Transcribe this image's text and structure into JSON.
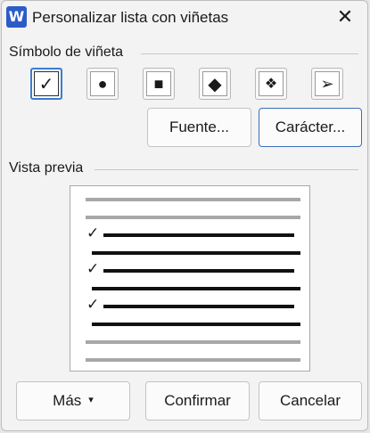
{
  "window": {
    "app_icon_letter": "W",
    "title": "Personalizar lista con viñetas",
    "close_glyph": "✕"
  },
  "bullet_symbol": {
    "label": "Símbolo de viñeta",
    "symbols": [
      {
        "glyph": "✓",
        "icon": "check-mark-icon",
        "selected": true
      },
      {
        "glyph": "●",
        "icon": "filled-circle-icon",
        "selected": false
      },
      {
        "glyph": "■",
        "icon": "filled-square-icon",
        "selected": false
      },
      {
        "glyph": "◆",
        "icon": "filled-diamond-icon",
        "selected": false
      },
      {
        "glyph": "❖",
        "icon": "four-diamonds-icon",
        "selected": false
      },
      {
        "glyph": "➢",
        "icon": "arrowhead-icon",
        "selected": false
      }
    ],
    "font_button": "Fuente...",
    "character_button": "Carácter..."
  },
  "preview": {
    "label": "Vista previa",
    "bullet_glyph": "✓"
  },
  "footer": {
    "more_button": "Más",
    "more_arrow": "▾",
    "confirm_button": "Confirmar",
    "cancel_button": "Cancelar"
  },
  "colors": {
    "selected_border": "#3a7bd5",
    "app_icon": "#2b5cc8"
  }
}
